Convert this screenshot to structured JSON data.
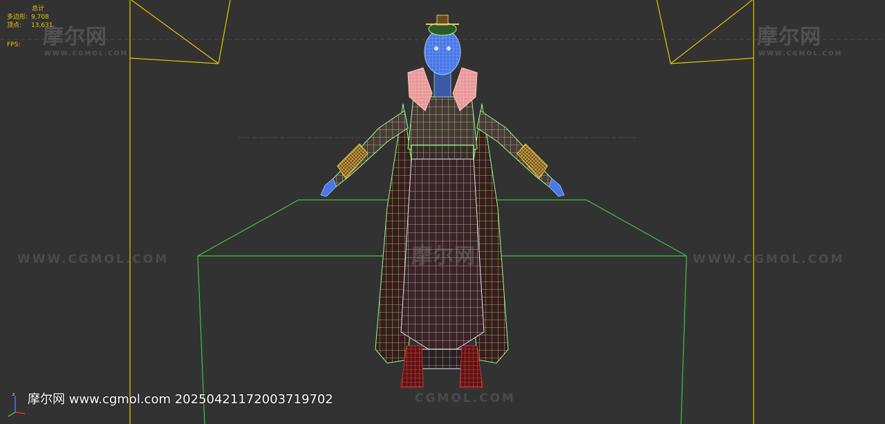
{
  "stats": {
    "title": "总计",
    "polys_label": "多边形:",
    "polys_value": "9,708",
    "verts_label": "顶点:",
    "verts_value": "13,631",
    "fps_label": "FPS:"
  },
  "watermarks": {
    "logo": "摩尔网",
    "logo_sub": "WWW.CGMOL.COM",
    "url": "WWW.CGMOL.COM",
    "url_bottom": "CGMOL.COM"
  },
  "caption": "摩尔网 www.cgmol.com 20250421172003719702",
  "colors": {
    "background": "#323232",
    "frustum": "#e6c800",
    "box": "#3cc83c",
    "wire_green": "#9cff8c",
    "wire_white": "#e6e6ff",
    "skin_blue": "#4a78e6",
    "fur_pink": "#f0a0a0",
    "gold": "#e6b43c",
    "boots_red": "#c83232",
    "cloth_dark": "#3c1e1e"
  },
  "icons": {
    "axis": "axis-gizmo-icon"
  }
}
